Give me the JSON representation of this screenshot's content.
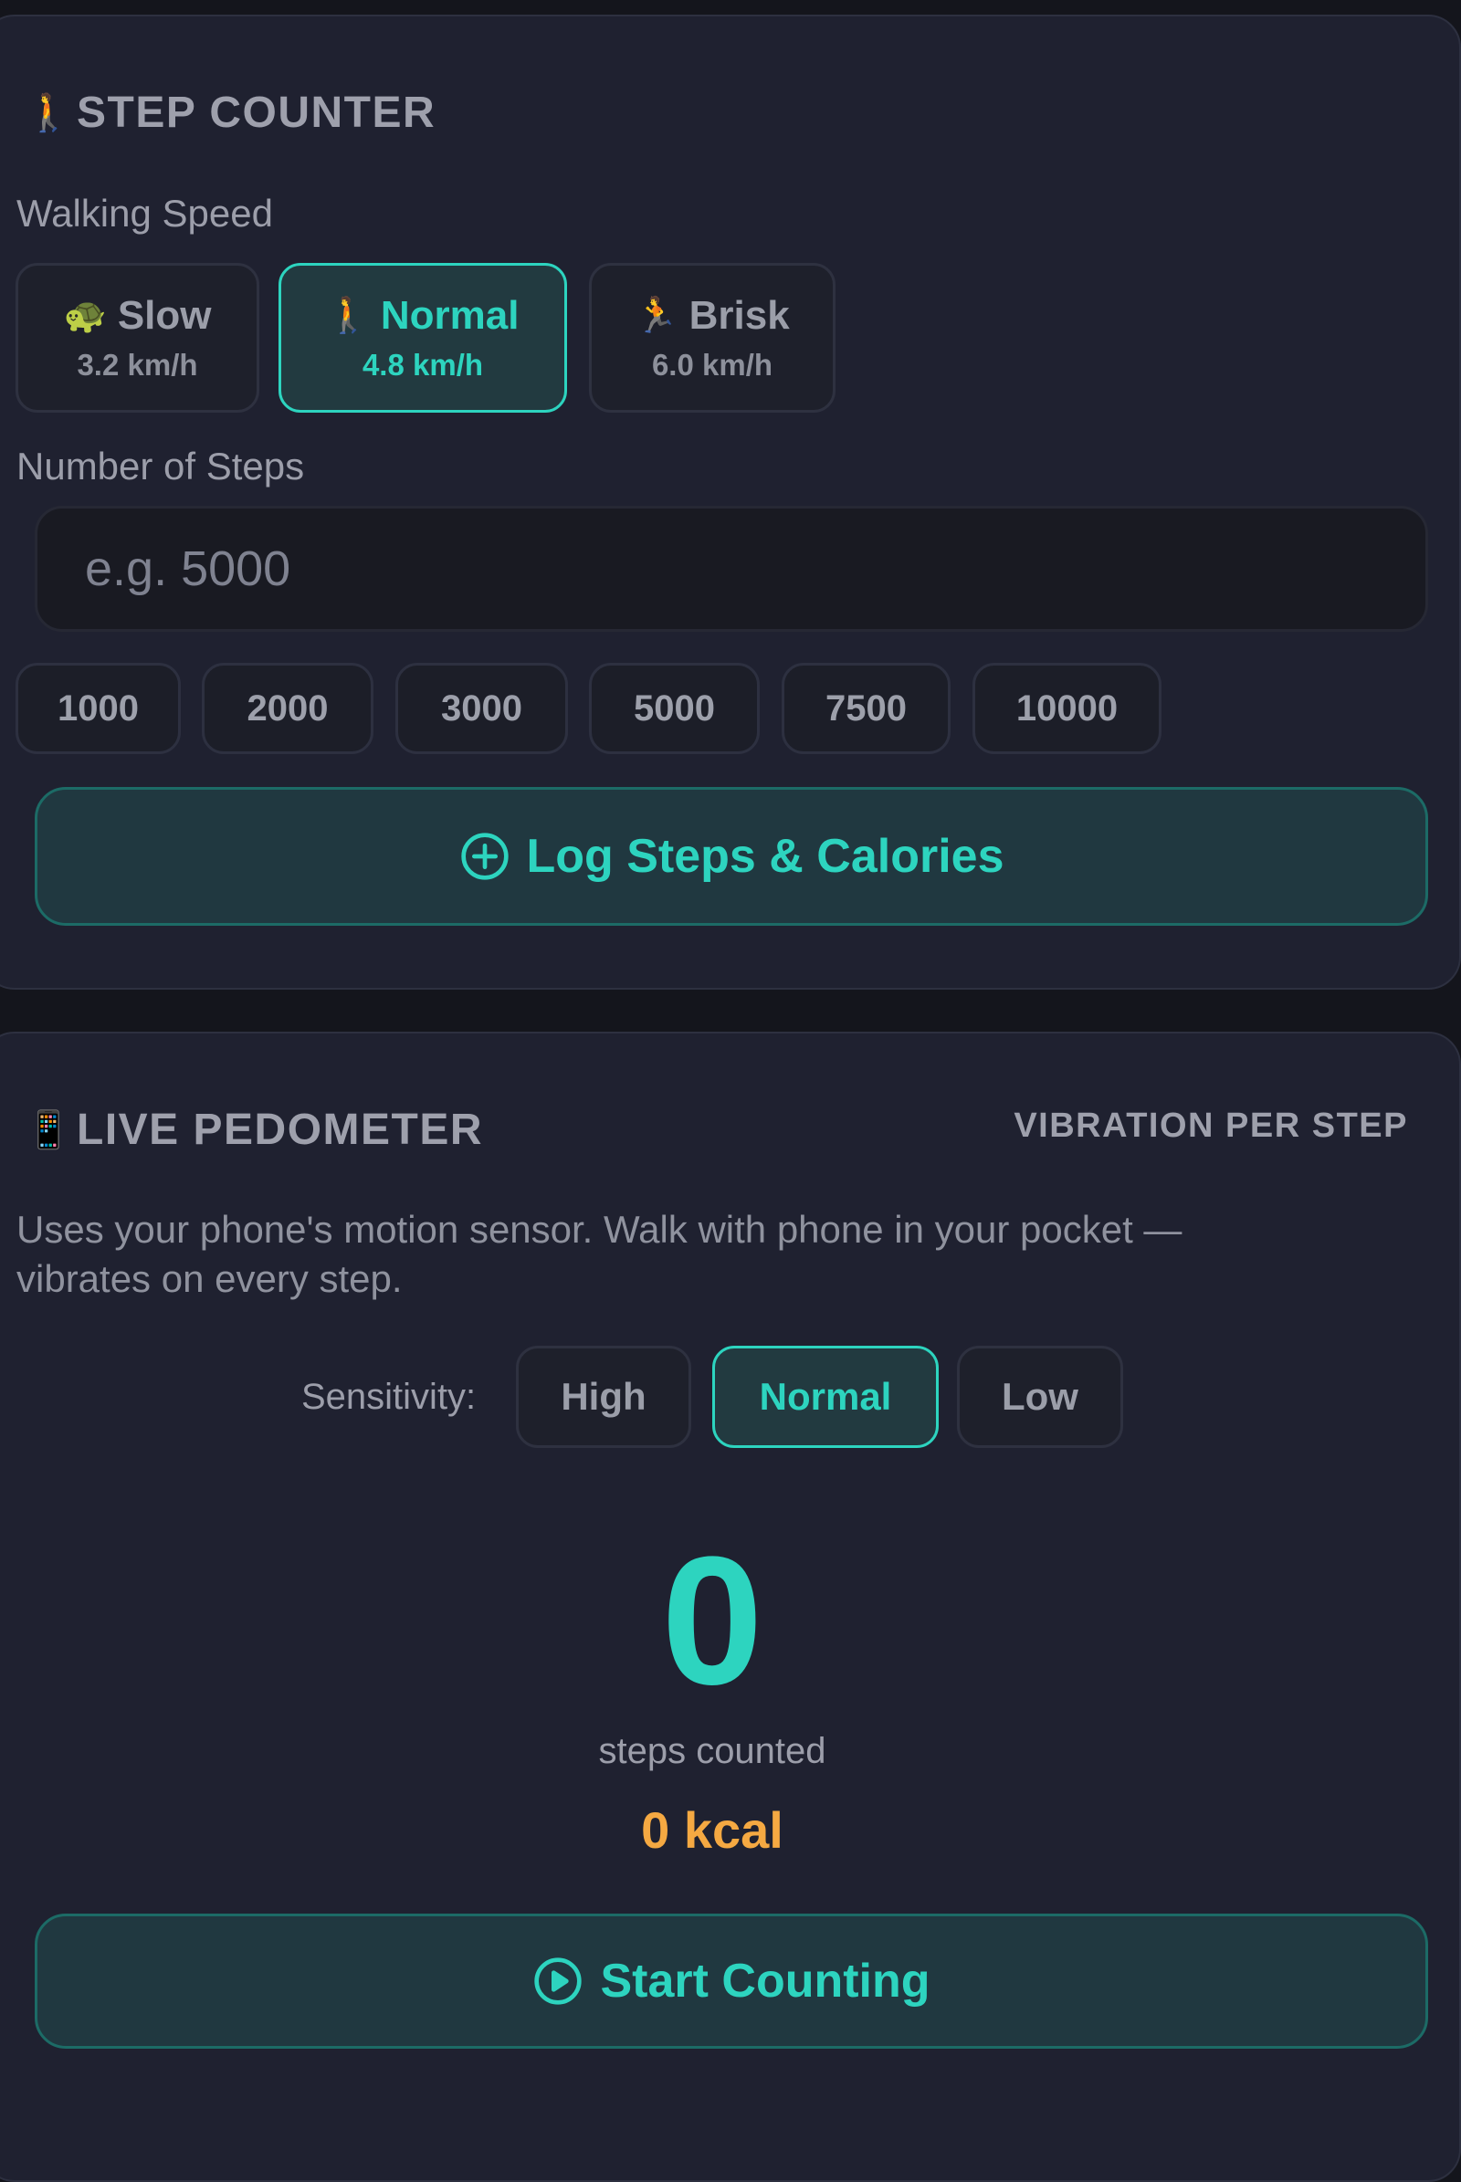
{
  "step_counter": {
    "icon": "🚶",
    "title": "STEP COUNTER",
    "speed_label": "Walking Speed",
    "speeds": [
      {
        "icon": "🐢",
        "name": "Slow",
        "rate": "3.2 km/h",
        "active": false
      },
      {
        "icon": "🚶",
        "name": "Normal",
        "rate": "4.8 km/h",
        "active": true
      },
      {
        "icon": "🏃",
        "name": "Brisk",
        "rate": "6.0 km/h",
        "active": false
      }
    ],
    "steps_label": "Number of Steps",
    "steps_placeholder": "e.g. 5000",
    "steps_value": "",
    "presets": [
      "1000",
      "2000",
      "3000",
      "5000",
      "7500",
      "10000"
    ],
    "log_button_icon": "plus-circle-icon",
    "log_button_label": "Log Steps & Calories"
  },
  "live_pedometer": {
    "icon": "📱",
    "title": "LIVE PEDOMETER",
    "vibration_label": "VIBRATION PER STEP",
    "description_line1": "Uses your phone's motion sensor. Walk with phone in your pocket —",
    "description_line2": "vibrates on every step.",
    "sensitivity_label": "Sensitivity:",
    "sensitivity_options": [
      {
        "label": "High",
        "active": false
      },
      {
        "label": "Normal",
        "active": true
      },
      {
        "label": "Low",
        "active": false
      }
    ],
    "step_count": "0",
    "step_count_caption": "steps counted",
    "kcal": "0 kcal",
    "start_button_icon": "play-circle-icon",
    "start_button_label": "Start Counting"
  },
  "colors": {
    "accent": "#2dd4bf",
    "kcal": "#f5a942",
    "background": "#14151c",
    "card": "#1f2130"
  }
}
